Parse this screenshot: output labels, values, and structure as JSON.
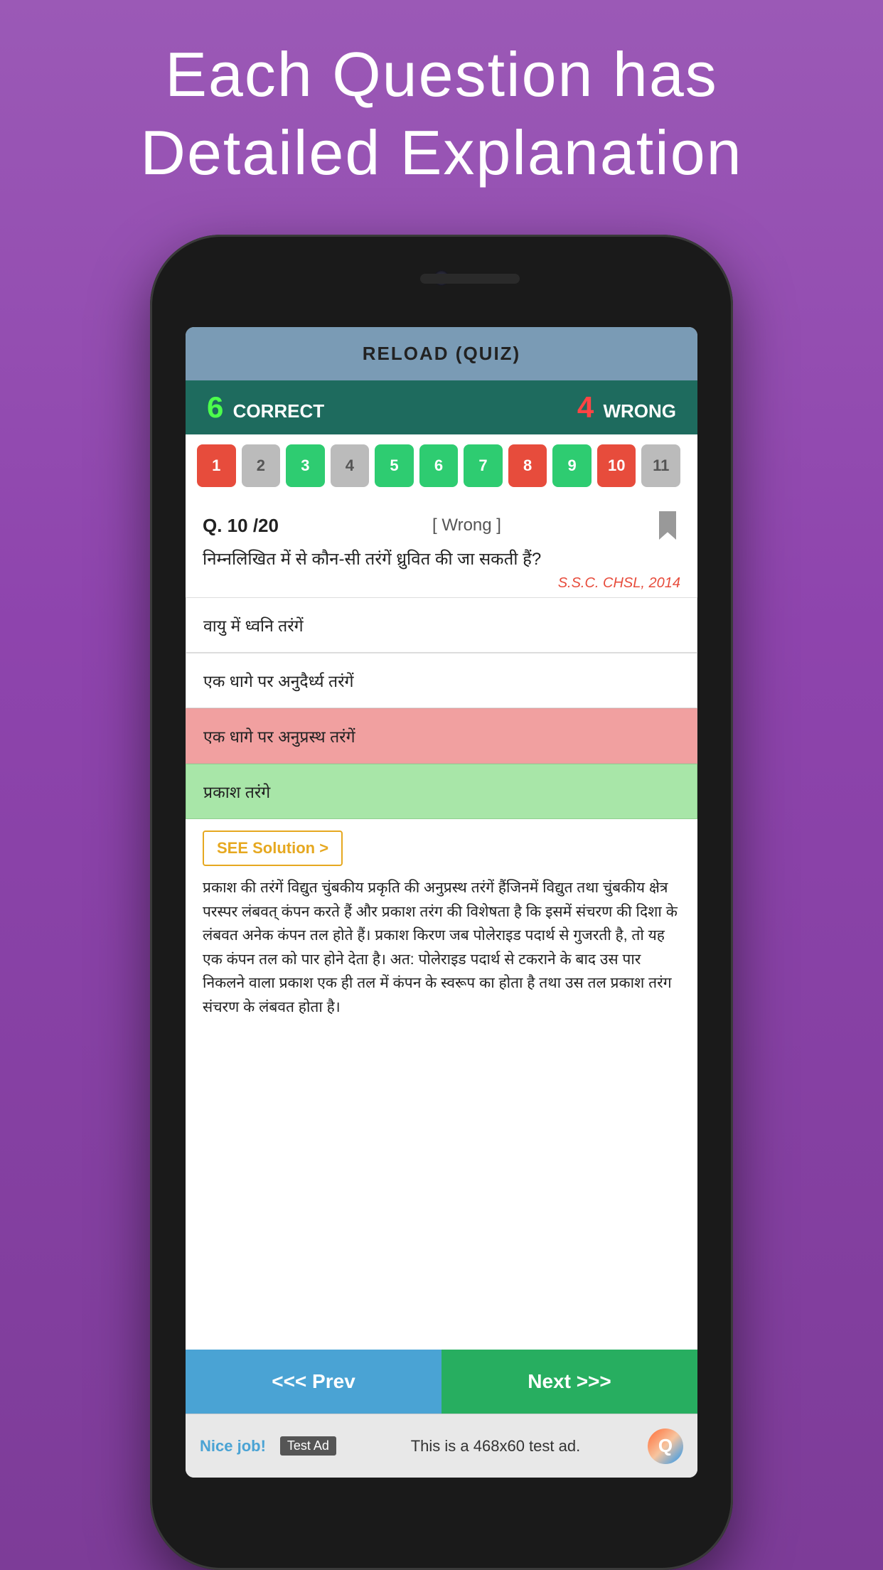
{
  "hero": {
    "title_line1": "Each  Question   has",
    "title_line2": "Detailed   Explanation"
  },
  "app": {
    "header": "RELOAD (QUIZ)",
    "score": {
      "correct_num": "6",
      "correct_label": "CORRECT",
      "wrong_num": "4",
      "wrong_label": "WRONG"
    }
  },
  "pills": [
    {
      "number": "1",
      "state": "wrong"
    },
    {
      "number": "2",
      "state": "neutral"
    },
    {
      "number": "3",
      "state": "correct"
    },
    {
      "number": "4",
      "state": "neutral"
    },
    {
      "number": "5",
      "state": "correct"
    },
    {
      "number": "6",
      "state": "correct"
    },
    {
      "number": "7",
      "state": "correct"
    },
    {
      "number": "8",
      "state": "wrong"
    },
    {
      "number": "9",
      "state": "correct"
    },
    {
      "number": "10",
      "state": "wrong"
    },
    {
      "number": "11",
      "state": "neutral"
    }
  ],
  "question": {
    "number": "Q. 10 /20",
    "status": "[ Wrong ]",
    "text": "निम्नलिखित में से कौन-सी तरंगें ध्रुवित की जा सकती हैं?",
    "source": "S.S.C. CHSL, 2014"
  },
  "options": [
    {
      "text": "वायु में ध्वनि तरंगें",
      "state": "normal"
    },
    {
      "text": "एक धागे पर अनुदैर्ध्य तरंगें",
      "state": "normal"
    },
    {
      "text": "एक धागे पर अनुप्रस्थ तरंगें",
      "state": "wrong"
    },
    {
      "text": "प्रकाश तरंगे",
      "state": "correct"
    }
  ],
  "solution": {
    "button_label": "SEE Solution >",
    "text": "प्रकाश की तरंगें विद्युत चुंबकीय प्रकृति की अनुप्रस्थ तरंगें हैंजिनमें विद्युत तथा चुंबकीय क्षेत्र परस्पर लंबवत् कंपन करते हैं और प्रकाश तरंग की विशेषता है कि इसमें संचरण की दिशा के लंबवत अनेक कंपन तल होते हैं। प्रकाश किरण जब पोलेराइड पदार्थ से गुजरती है, तो यह एक कंपन तल को पार होने देता है। अत: पोलेराइड पदार्थ से टकराने के बाद उस पार निकलने वाला प्रकाश एक ही तल में कंपन के स्वरूप का होता है तथा उस तल प्रकाश तरंग संचरण के लंबवत होता है।"
  },
  "nav": {
    "prev_label": "<<< Prev",
    "next_label": "Next >>>"
  },
  "ad": {
    "label": "Test Ad",
    "nice_text": "Nice job!",
    "ad_text": "This is a 468x60 test ad.",
    "logo_letter": "Q"
  }
}
